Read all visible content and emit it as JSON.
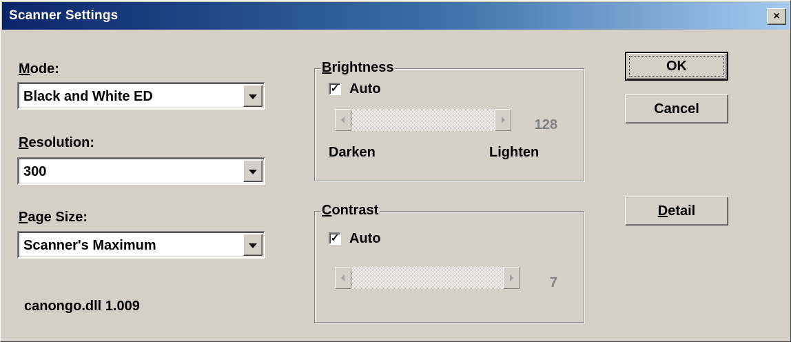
{
  "window": {
    "title": "Scanner Settings",
    "close_glyph": "×",
    "close_icon": "close-icon"
  },
  "mode": {
    "label_mnemonic": "M",
    "label_rest": "ode:",
    "value": "Black and White ED"
  },
  "resolution": {
    "label_mnemonic": "R",
    "label_rest": "esolution:",
    "value": "300"
  },
  "page_size": {
    "label_mnemonic": "P",
    "label_rest": "age Size:",
    "value": "Scanner's Maximum"
  },
  "brightness": {
    "legend_mnemonic": "B",
    "legend_rest": "rightness",
    "auto_label": "Auto",
    "auto_checked": true,
    "check_glyph": "✓",
    "value": "128",
    "min_label": "Darken",
    "max_label": "Lighten"
  },
  "contrast": {
    "legend_mnemonic": "C",
    "legend_rest": "ontrast",
    "auto_label": "Auto",
    "auto_checked": true,
    "check_glyph": "✓",
    "value": "7"
  },
  "buttons": {
    "ok": "OK",
    "cancel": "Cancel",
    "detail_mnemonic": "D",
    "detail_rest": "etail"
  },
  "version_text": "canongo.dll 1.009",
  "colors": {
    "face": "#d4d0c8",
    "title_start": "#0a246a",
    "title_end": "#a6caf0",
    "disabled_text": "#808080"
  }
}
